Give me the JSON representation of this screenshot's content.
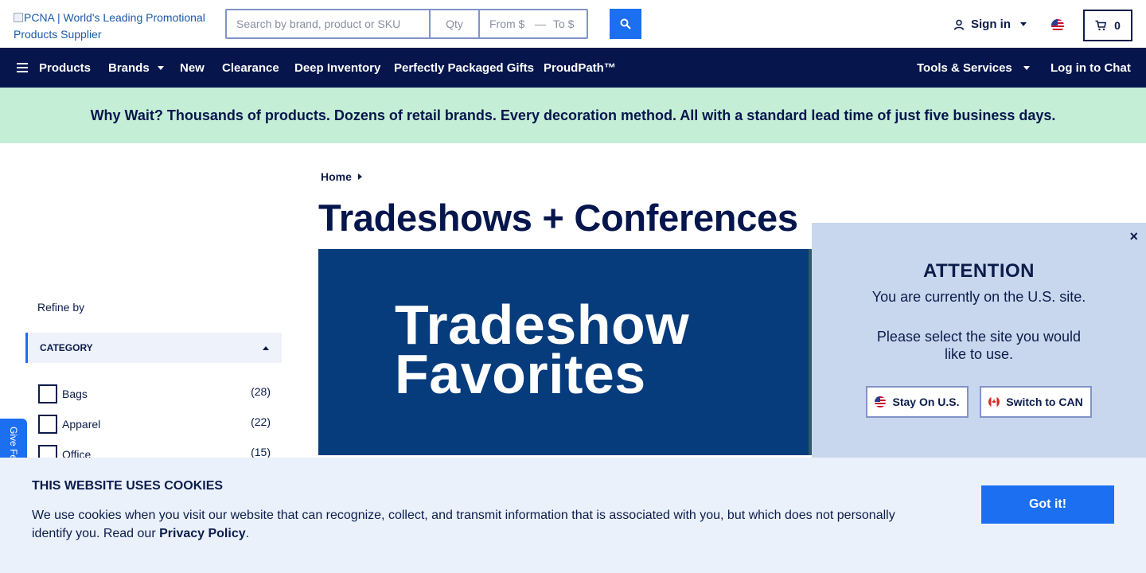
{
  "header": {
    "logo_alt": "PCNA | World's Leading Promotional Products Supplier",
    "search": {
      "placeholder": "Search by brand, product or SKU",
      "value": ""
    },
    "qty": {
      "placeholder": "Qty"
    },
    "price_from": {
      "placeholder": "From $"
    },
    "price_dash": "—",
    "price_to": {
      "placeholder": "To $"
    },
    "signin_label": "Sign in",
    "cart_count": "0"
  },
  "nav": {
    "products": "Products",
    "brands": "Brands",
    "new": "New",
    "clearance": "Clearance",
    "deep_inventory": "Deep Inventory",
    "perfectly_packaged": "Perfectly Packaged Gifts",
    "proudpath": "ProudPath™",
    "tools": "Tools & Services",
    "chat": "Log in to Chat"
  },
  "banner": {
    "text": "Why Wait? Thousands of products. Dozens of retail brands. Every decoration method. All with a standard lead time of just five business days."
  },
  "breadcrumb": {
    "home": "Home"
  },
  "page_title": "Tradeshows + Conferences",
  "hero": {
    "line1": "Tradeshow",
    "line2": "Favorites"
  },
  "sidebar": {
    "refine_label": "Refine by",
    "category_header": "CATEGORY",
    "categories": [
      {
        "label": "Bags",
        "count": "(28)"
      },
      {
        "label": "Apparel",
        "count": "(22)"
      },
      {
        "label": "Office",
        "count": "(15)"
      }
    ],
    "feedback_label": "Give Feedback"
  },
  "attention": {
    "close": "×",
    "heading": "ATTENTION",
    "line1": "You are currently on the U.S. site.",
    "line2": "Please select the site you would like to use.",
    "stay_label": "Stay On U.S.",
    "switch_label": "Switch to CAN"
  },
  "cookie": {
    "heading": "THIS WEBSITE USES COOKIES",
    "text": "We use cookies when you visit our website that can recognize, collect, and transmit information that is associated with you, but which does not personally identify you. Read our ",
    "link": "Privacy Policy",
    "end": ".",
    "button": "Got it!"
  },
  "colors": {
    "navy": "#06164d",
    "accent_blue": "#1b6ff0",
    "banner_green": "#c5eed6",
    "hero_blue": "#063b7c",
    "attention_bg": "#c9d7ee",
    "cookie_bg": "#eaf1fb"
  },
  "icons": {
    "search": "search-icon",
    "user": "user-icon",
    "flag": "us-flag-icon",
    "cart": "cart-icon",
    "menu": "hamburger-icon"
  }
}
